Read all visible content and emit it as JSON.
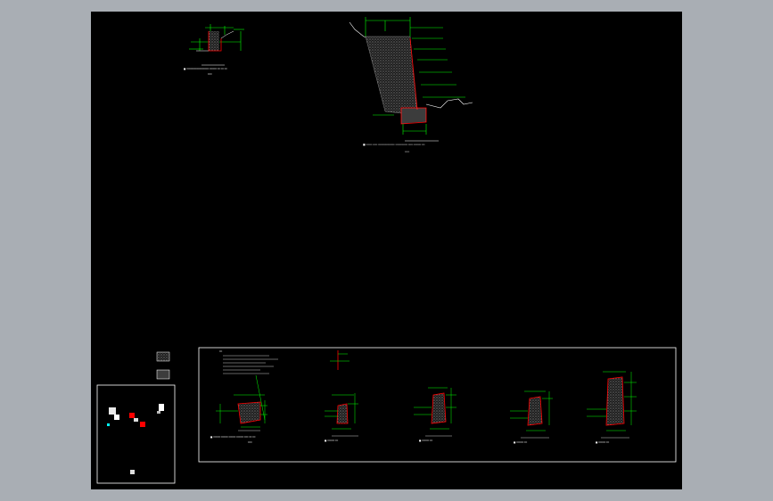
{
  "app": {
    "window_title": "",
    "colors": {
      "background": "#a9aeb4",
      "canvas": "#000000",
      "frame_line": "#ffffff",
      "dimension_line": "#00ff00",
      "section_line": "#ff0000",
      "hatch": "#8c8c8c",
      "grid_line": "#ffffff"
    }
  },
  "drawing": {
    "labels": {
      "detail_top_left": "",
      "detail_top_center": "",
      "section_1": "",
      "section_2": "",
      "section_3": "",
      "section_4": "",
      "section_5": ""
    }
  }
}
